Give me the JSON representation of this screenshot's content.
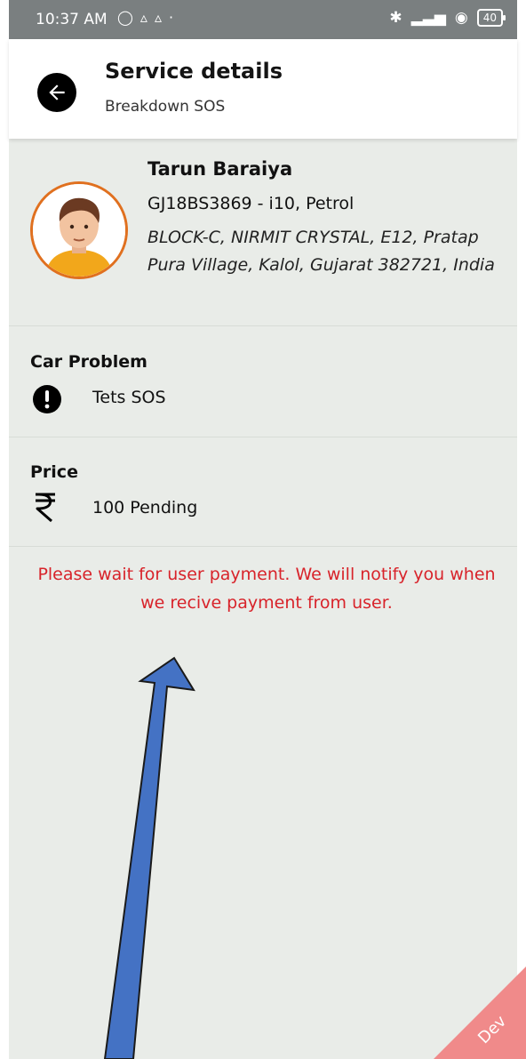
{
  "status_bar": {
    "time": "10:37 AM",
    "battery": "40"
  },
  "header": {
    "title": "Service details",
    "subtitle": "Breakdown SOS"
  },
  "customer": {
    "name": "Tarun Baraiya",
    "vehicle": "GJ18BS3869 - i10, Petrol",
    "address": "BLOCK-C, NIRMIT CRYSTAL, E12, Pratap Pura Village, Kalol, Gujarat 382721, India"
  },
  "car_problem": {
    "label": "Car Problem",
    "value": "Tets SOS"
  },
  "price": {
    "label": "Price",
    "value": "100 Pending"
  },
  "notice": "Please wait for user payment. We will notify you when we recive payment from user.",
  "ribbon": {
    "label": "Dev",
    "color": "#f08a8a"
  },
  "colors": {
    "background": "#e9ece8",
    "notice_text": "#d8232a",
    "avatar_border": "#e0701f",
    "arrow_fill": "#4472c4"
  },
  "icons": {
    "back": "arrow-left-icon",
    "problem": "exclamation-circle-icon",
    "price": "rupee-icon"
  }
}
